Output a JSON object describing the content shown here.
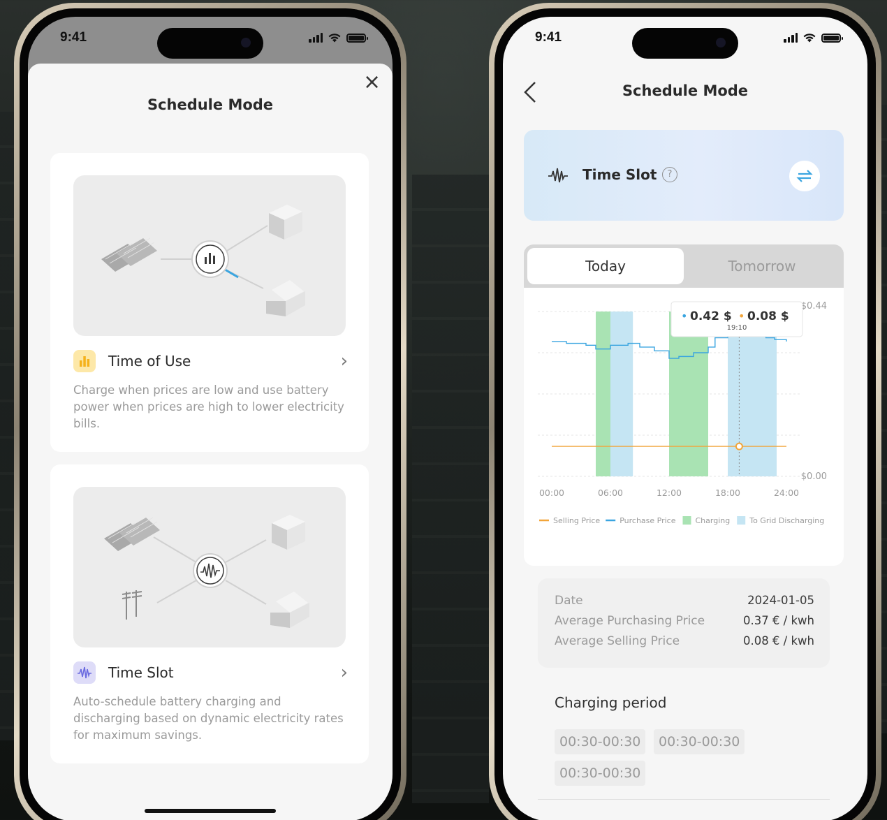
{
  "status_bar": {
    "time": "9:41"
  },
  "screen1": {
    "title": "Schedule Mode",
    "close_glyph": "×",
    "modes": [
      {
        "name": "Time of Use",
        "icon": "bar-chart-icon",
        "icon_bg": "#fde5a6",
        "icon_color": "#f5b21b",
        "description": "Charge when prices are low and use battery power when prices are high to lower electricity bills."
      },
      {
        "name": "Time Slot",
        "icon": "waveform-icon",
        "icon_bg": "#dcdcf7",
        "icon_color": "#6b6be0",
        "description": "Auto-schedule battery charging and discharging based on dynamic electricity rates for maximum savings."
      }
    ],
    "chevron_glyph": "›"
  },
  "screen2": {
    "title": "Schedule Mode",
    "banner": {
      "mode_name": "Time Slot",
      "help_glyph": "?",
      "accent": "#3aa5e0"
    },
    "tabs": [
      {
        "label": "Today",
        "active": true
      },
      {
        "label": "Tomorrow",
        "active": false
      }
    ],
    "tooltip": {
      "purchase_value": "0.42 $",
      "selling_value": "0.08 $",
      "time": "19:10",
      "bullet": "•"
    },
    "info": {
      "rows": [
        {
          "label": "Date",
          "value": "2024-01-05"
        },
        {
          "label": "Average Purchasing Price",
          "value": "0.37 € / kwh"
        },
        {
          "label": "Average Selling Price",
          "value": "0.08 € / kwh"
        }
      ]
    },
    "charging_period": {
      "title": "Charging period",
      "slots": [
        "00:30-00:30",
        "00:30-00:30",
        "00:30-00:30"
      ]
    }
  },
  "chart_data": {
    "type": "line",
    "x_ticks": [
      "00:00",
      "06:00",
      "12:00",
      "18:00",
      "24:00"
    ],
    "y_tick_labels": [
      "$0.44",
      "$0.00"
    ],
    "ylim": [
      0,
      0.44
    ],
    "xlim": [
      0,
      24
    ],
    "series": [
      {
        "name": "Purchase Price",
        "color": "#3aa5e0",
        "step": true,
        "points": [
          [
            0,
            0.36
          ],
          [
            1.5,
            0.355
          ],
          [
            3.5,
            0.35
          ],
          [
            4.5,
            0.34
          ],
          [
            6,
            0.35
          ],
          [
            7.8,
            0.355
          ],
          [
            9,
            0.345
          ],
          [
            10.5,
            0.335
          ],
          [
            12,
            0.315
          ],
          [
            13,
            0.32
          ],
          [
            14.5,
            0.33
          ],
          [
            16,
            0.345
          ],
          [
            16.7,
            0.37
          ],
          [
            18,
            0.38
          ],
          [
            19,
            0.4
          ],
          [
            19.9,
            0.39
          ],
          [
            20.9,
            0.38
          ],
          [
            21.9,
            0.37
          ],
          [
            22.8,
            0.365
          ],
          [
            24,
            0.36
          ]
        ]
      },
      {
        "name": "Selling Price",
        "color": "#f2a53a",
        "points": [
          [
            0,
            0.08
          ],
          [
            24,
            0.08
          ]
        ]
      }
    ],
    "ranges": [
      {
        "name": "Charging",
        "color": "#a9e3b3",
        "from": 4.5,
        "to": 6
      },
      {
        "name": "To Grid Discharging",
        "color": "#c5e5f3",
        "from": 6,
        "to": 8.3
      },
      {
        "name": "Charging",
        "color": "#a9e3b3",
        "from": 12,
        "to": 16
      },
      {
        "name": "To Grid Discharging",
        "color": "#c5e5f3",
        "from": 18,
        "to": 23
      }
    ],
    "marker_x": 19.17,
    "legend": [
      {
        "label": "Selling Price",
        "color": "#f2a53a",
        "kind": "line"
      },
      {
        "label": "Purchase Price",
        "color": "#3aa5e0",
        "kind": "line"
      },
      {
        "label": "Charging",
        "color": "#a9e3b3",
        "kind": "box"
      },
      {
        "label": "To Grid Discharging",
        "color": "#c5e5f3",
        "kind": "box"
      }
    ],
    "legend_position": "bottom",
    "grid": true
  }
}
